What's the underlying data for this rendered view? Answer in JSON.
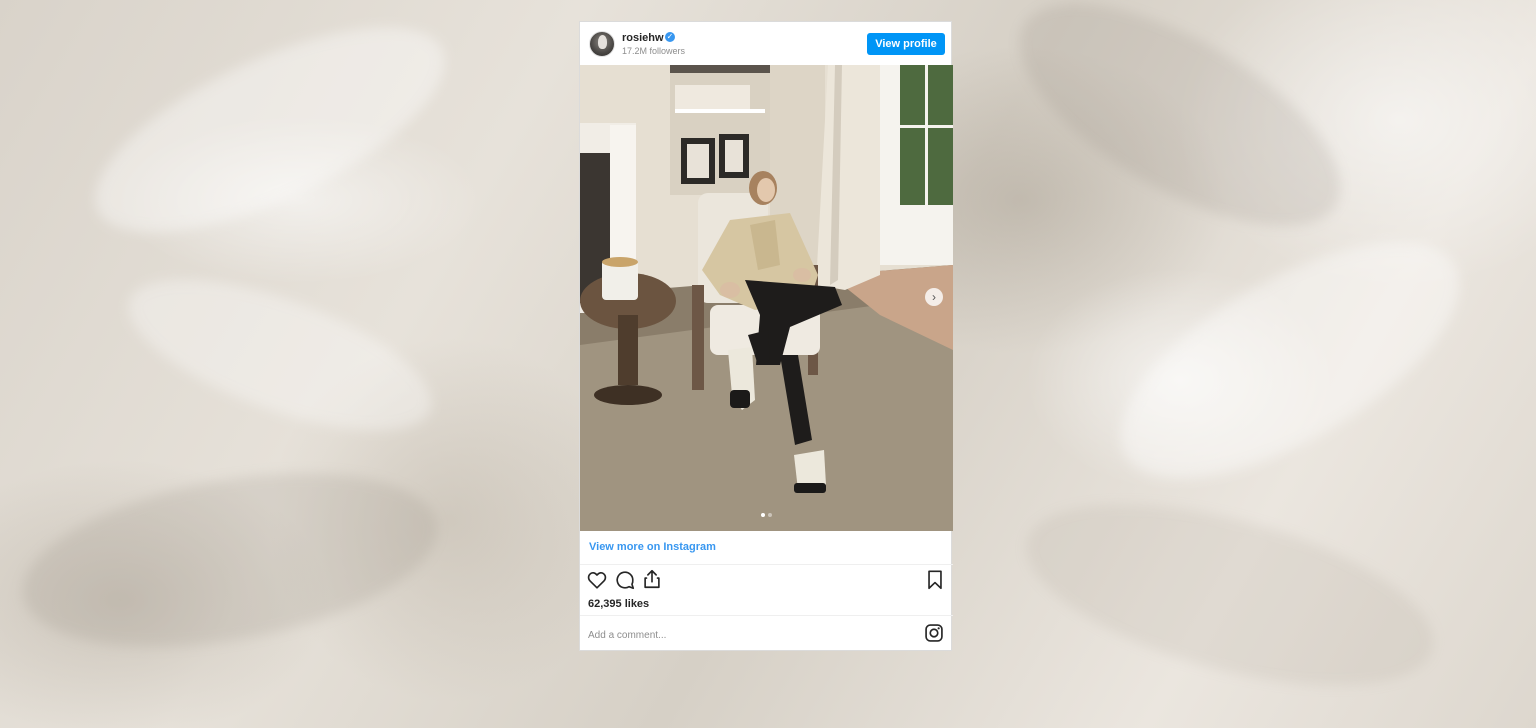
{
  "post": {
    "username": "rosiehw",
    "verified_icon": "verified-badge-icon",
    "followers": "17.2M followers",
    "view_profile_label": "View profile",
    "view_more_label": "View more on Instagram",
    "likes": "62,395 likes",
    "comment_placeholder": "Add a comment...",
    "carousel": {
      "current": 1,
      "total": 2
    },
    "icons": {
      "like": "heart-icon",
      "comment": "comment-icon",
      "share": "share-icon",
      "save": "bookmark-icon",
      "brand": "instagram-icon",
      "next": "chevron-right-icon"
    }
  },
  "colors": {
    "accent": "#0095f6",
    "link": "#3897f0",
    "text": "#262626",
    "muted": "#8e8e8e"
  }
}
